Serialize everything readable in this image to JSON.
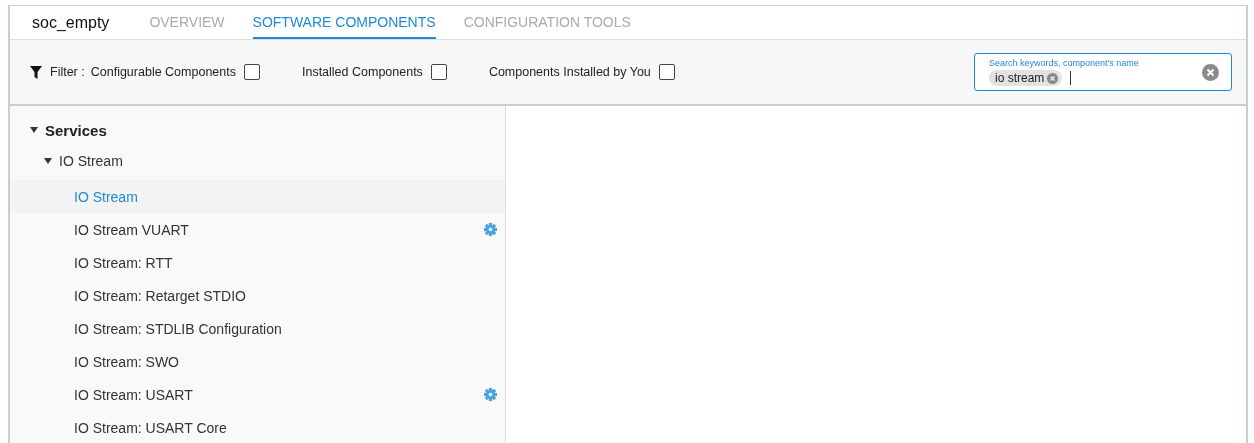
{
  "project": {
    "title": "soc_empty"
  },
  "tabs": [
    {
      "label": "OVERVIEW",
      "selected": false
    },
    {
      "label": "SOFTWARE COMPONENTS",
      "selected": true
    },
    {
      "label": "CONFIGURATION TOOLS",
      "selected": false
    }
  ],
  "filter": {
    "label": "Filter :",
    "options": [
      {
        "label": "Configurable Components",
        "checked": false
      },
      {
        "label": "Installed Components",
        "checked": false
      },
      {
        "label": "Components Installed by You",
        "checked": false
      }
    ]
  },
  "search": {
    "placeholder": "Search keywords, component's name",
    "tokens": [
      "io stream"
    ]
  },
  "tree": [
    {
      "label": "Services",
      "expanded": true,
      "children": [
        {
          "label": "IO Stream",
          "expanded": true,
          "children": [
            {
              "label": "IO Stream",
              "selected": true,
              "configurable": false
            },
            {
              "label": "IO Stream VUART",
              "selected": false,
              "configurable": true
            },
            {
              "label": "IO Stream: RTT",
              "selected": false,
              "configurable": false
            },
            {
              "label": "IO Stream: Retarget STDIO",
              "selected": false,
              "configurable": false
            },
            {
              "label": "IO Stream: STDLIB Configuration",
              "selected": false,
              "configurable": false
            },
            {
              "label": "IO Stream: SWO",
              "selected": false,
              "configurable": false
            },
            {
              "label": "IO Stream: USART",
              "selected": false,
              "configurable": true
            },
            {
              "label": "IO Stream: USART Core",
              "selected": false,
              "configurable": false
            }
          ]
        }
      ]
    }
  ]
}
